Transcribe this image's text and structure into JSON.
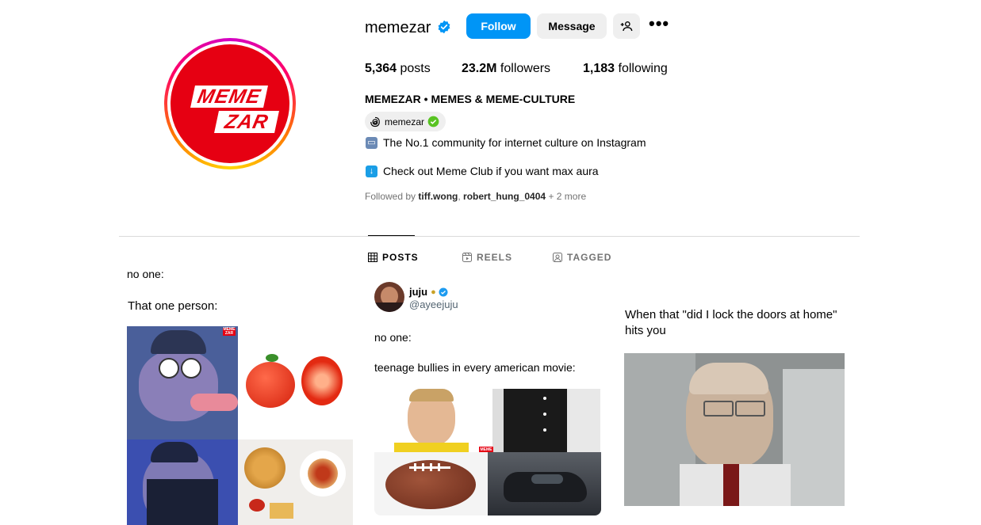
{
  "profile": {
    "username": "memezar",
    "follow_label": "Follow",
    "message_label": "Message",
    "more_label": "•••",
    "logo_line1": "MEME",
    "logo_line2": "ZAR",
    "posts_count": "5,364",
    "posts_label": "posts",
    "followers_count": "23.2M",
    "followers_label": "followers",
    "following_count": "1,183",
    "following_label": "following",
    "full_name": "MEMEZAR • MEMES & MEME-CULTURE",
    "threads_handle": "memezar",
    "bio_line1": "The No.1 community for internet culture on Instagram",
    "bio_line2": "Check out Meme Club if you want max aura",
    "followed_by_prefix": "Followed by",
    "followed_by_user1": "tiff.wong",
    "followed_by_sep": ",",
    "followed_by_user2": "robert_hung_0404",
    "followed_by_more": "+ 2 more"
  },
  "tabs": [
    {
      "label": "POSTS",
      "icon": "grid-icon",
      "active": true
    },
    {
      "label": "REELS",
      "icon": "reels-icon",
      "active": false
    },
    {
      "label": "TAGGED",
      "icon": "tagged-icon",
      "active": false
    }
  ],
  "posts": [
    {
      "top_text": "no one:",
      "caption": "That one person:",
      "watermark": "MEME ZAR"
    },
    {
      "author_name": "juju",
      "author_handle": "@ayeejuju",
      "line1": "no one:",
      "line2": "teenage bullies in every american movie:",
      "watermark": "MEME ZAR"
    },
    {
      "caption": "When that \"did I lock the doors at home\" hits you"
    }
  ],
  "colors": {
    "accent": "#0095f6",
    "brand_red": "#e60012",
    "verified": "#0095f6"
  }
}
